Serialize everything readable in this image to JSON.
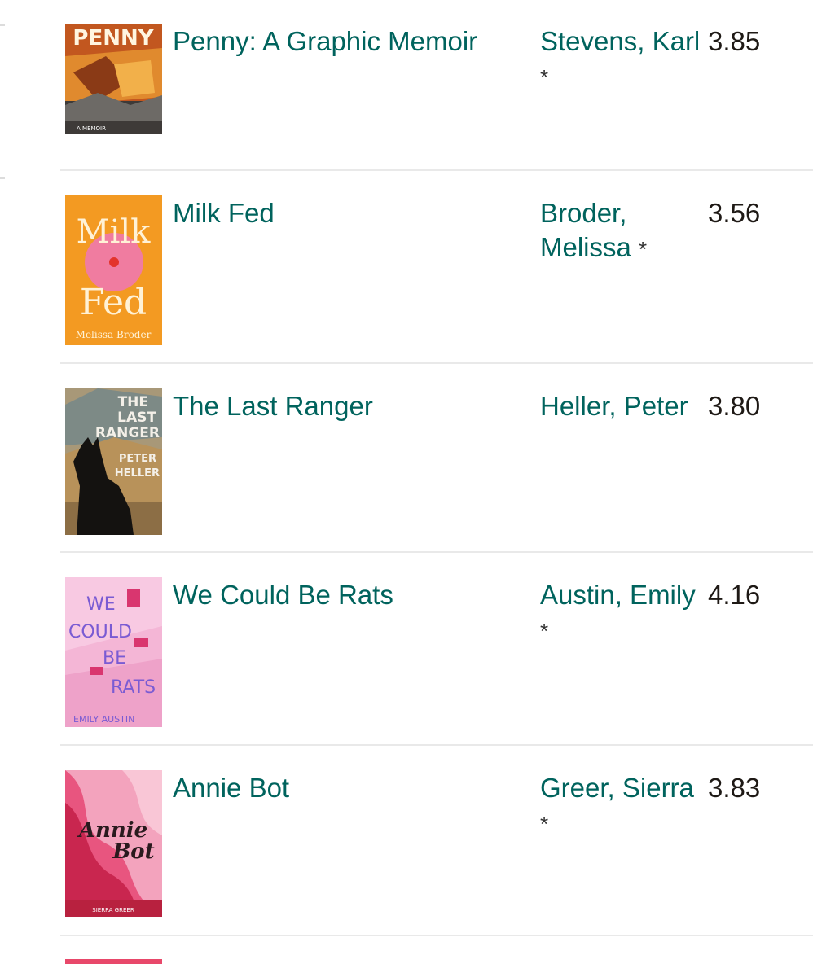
{
  "colors": {
    "link": "#00635d",
    "text": "#1e1915",
    "divider": "#e9e9e9"
  },
  "books": [
    {
      "title": "Penny: A Graphic Memoir",
      "author": "Stevens, Karl",
      "star": "*",
      "rating": "3.85",
      "cover": {
        "text1": "PENNY",
        "text2": "A MEMOIR"
      }
    },
    {
      "title": "Milk Fed",
      "author": "Broder, Melissa",
      "star": "*",
      "rating": "3.56",
      "cover": {
        "text1": "Milk",
        "text2": "Fed",
        "text3": "Melissa Broder"
      }
    },
    {
      "title": "The Last Ranger",
      "author": "Heller, Peter",
      "star": "",
      "rating": "3.80",
      "cover": {
        "text1": "THE",
        "text2": "LAST",
        "text3": "RANGER",
        "text4": "PETER",
        "text5": "HELLER"
      }
    },
    {
      "title": "We Could Be Rats",
      "author": "Austin, Emily",
      "star": "*",
      "rating": "4.16",
      "cover": {
        "text1": "WE",
        "text2": "COULD",
        "text3": "BE",
        "text4": "RATS",
        "text5": "EMILY AUSTIN"
      }
    },
    {
      "title": "Annie Bot",
      "author": "Greer, Sierra",
      "star": "*",
      "rating": "3.83",
      "cover": {
        "text1": "Annie",
        "text2": "Bot",
        "text3": "SIERRA GREER"
      }
    }
  ]
}
